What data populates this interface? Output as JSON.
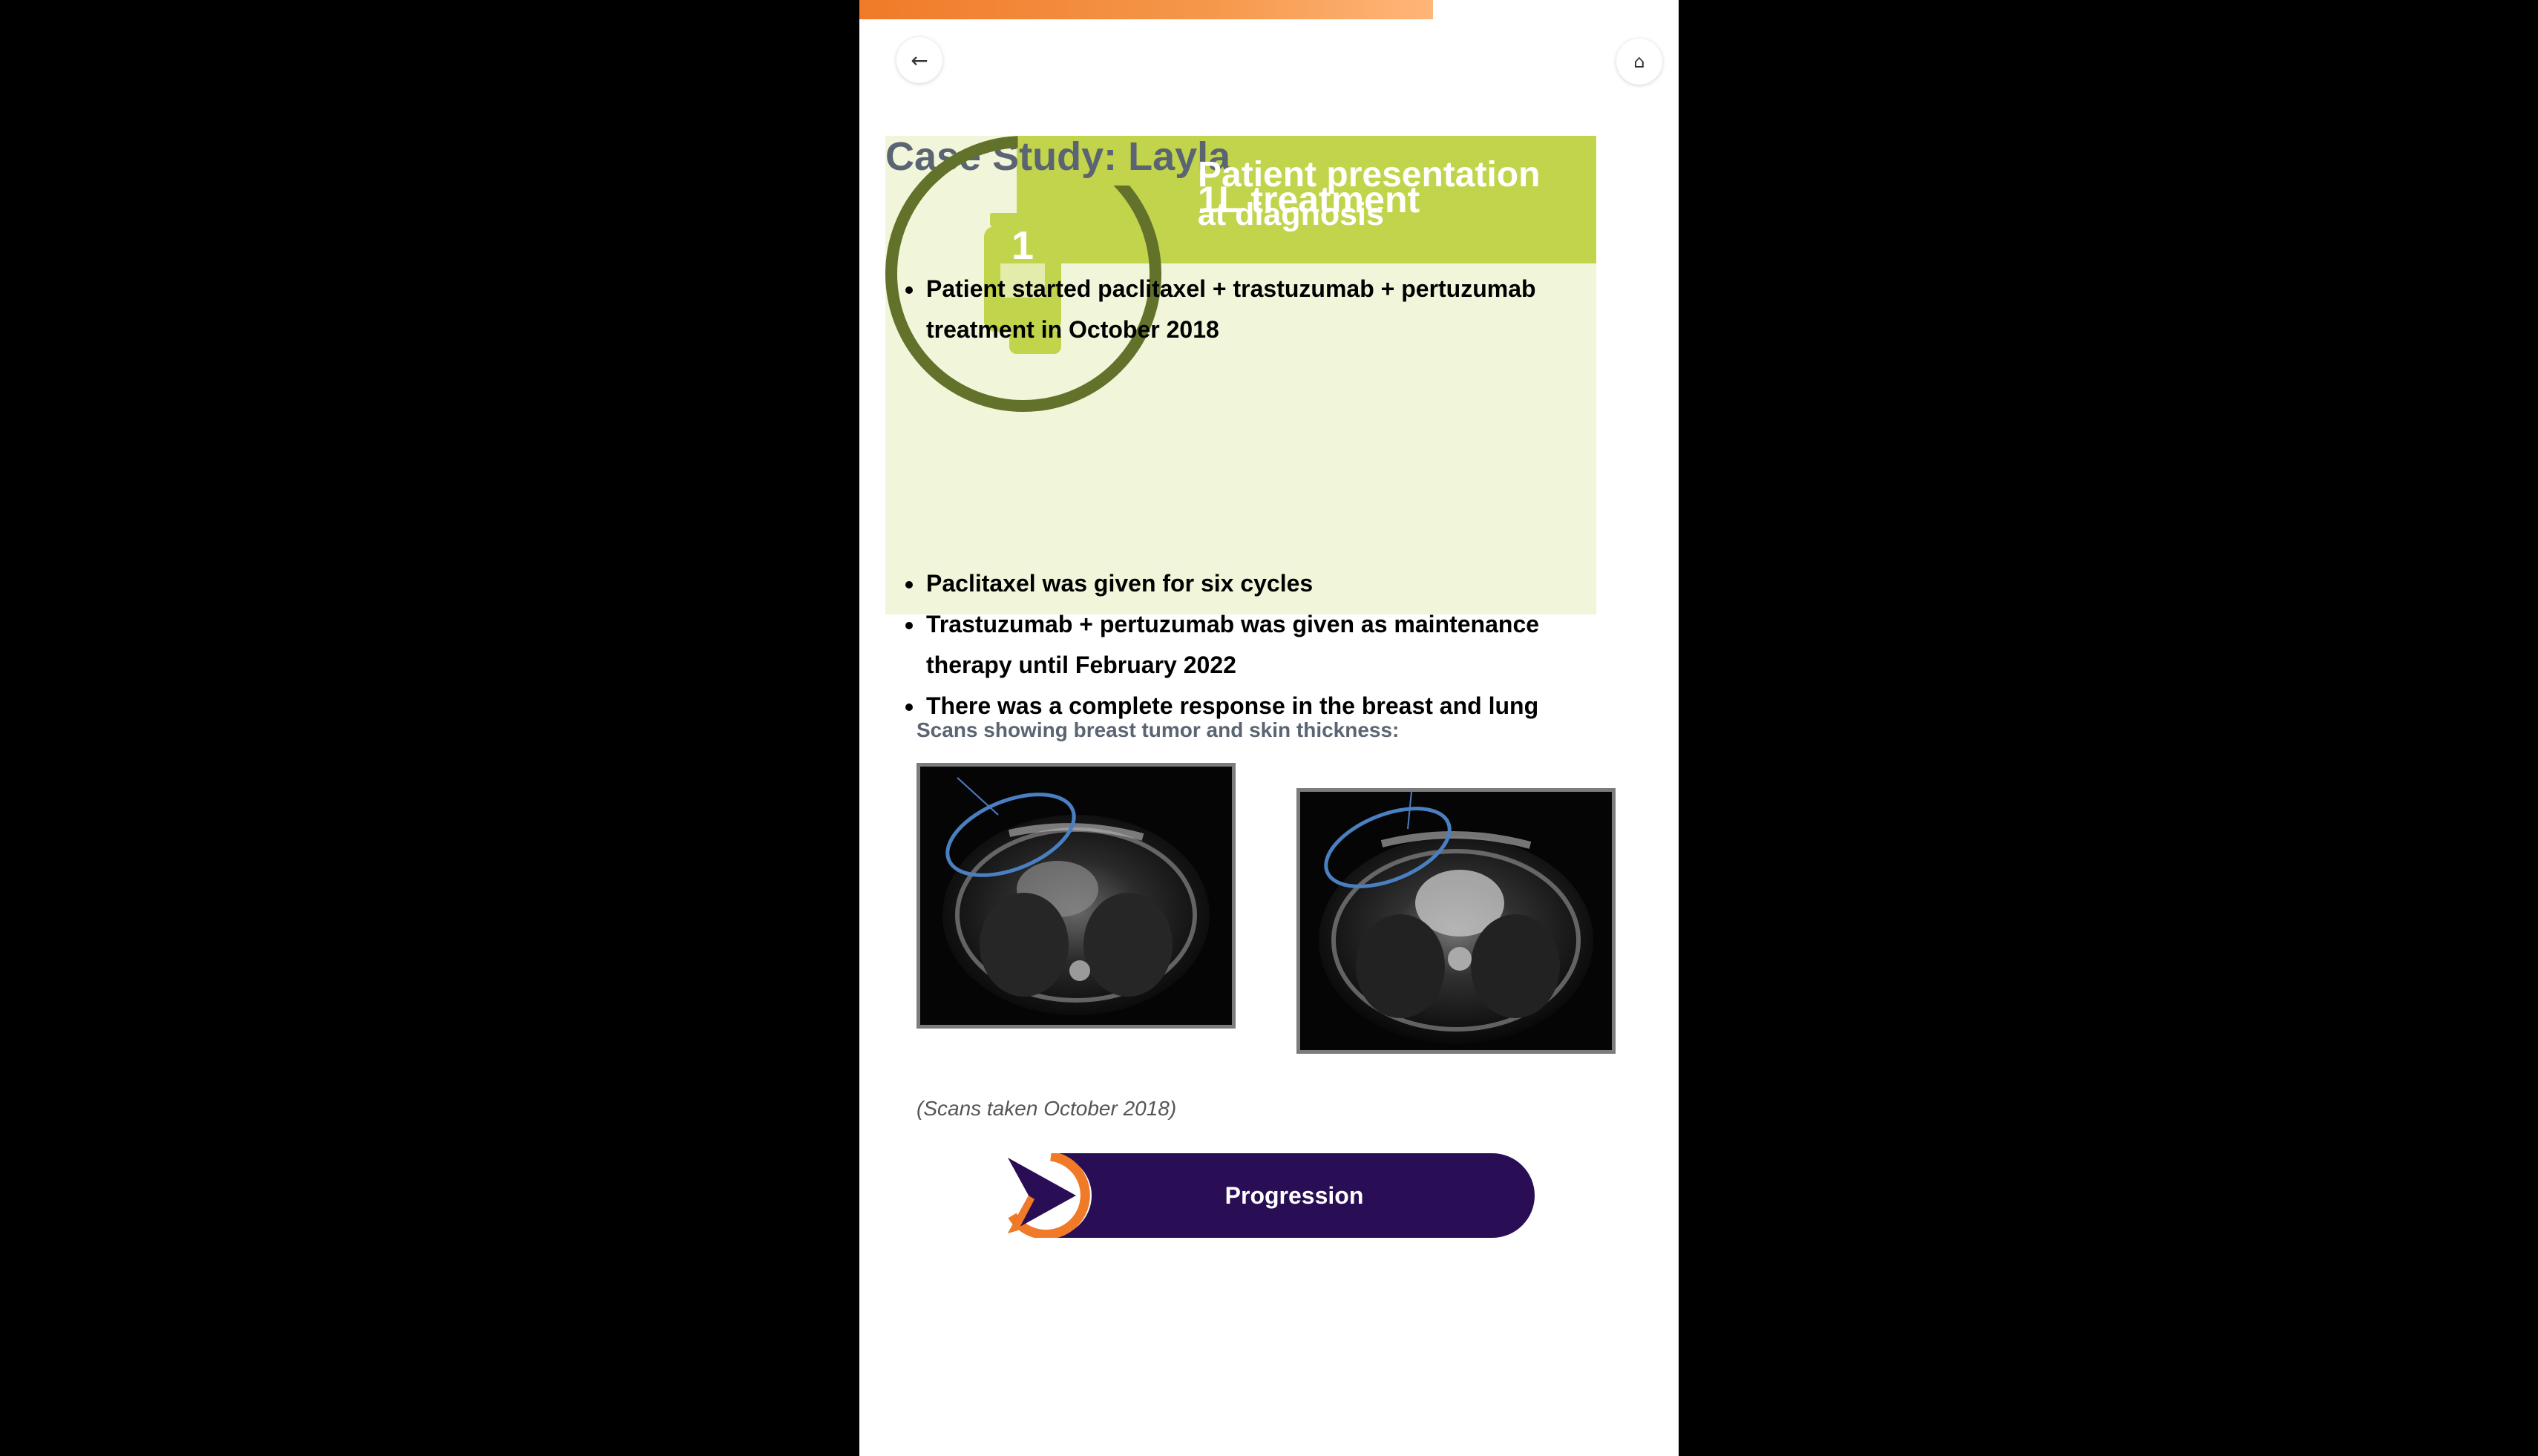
{
  "progress": {
    "fraction": 0.7
  },
  "nav": {
    "back_icon": "←",
    "home_icon": "⌂"
  },
  "page": {
    "title": "Case Study: Layla",
    "section_heading_1": "Patient presentation",
    "section_heading_2": "at diagnosis",
    "section_heading_3": "1L treatment",
    "step_number": "1"
  },
  "treatment_bullets": [
    "Patient started paclitaxel + trastuzumab + pertuzumab treatment in October 2018"
  ],
  "outcome_bullets": [
    "Paclitaxel was given for six cycles",
    "Trastuzumab + pertuzumab was given as maintenance therapy until February 2022",
    "There was a complete response in the breast and lung"
  ],
  "scans": {
    "label": "Scans showing breast tumor and skin thickness:",
    "caption": "(Scans taken October 2018)"
  },
  "next_button": {
    "label": "Progression"
  },
  "colors": {
    "accent_orange": "#f07a28",
    "lime": "#c1d44b",
    "lime_light": "#f1f6da",
    "olive": "#63722a",
    "button_purple": "#2a0e55",
    "scan_highlight": "#4a7fc1"
  },
  "icons": {
    "back": "arrow-left-icon",
    "home": "home-icon",
    "step": "medicine-bottle-icon",
    "next": "play-arrow-icon"
  }
}
